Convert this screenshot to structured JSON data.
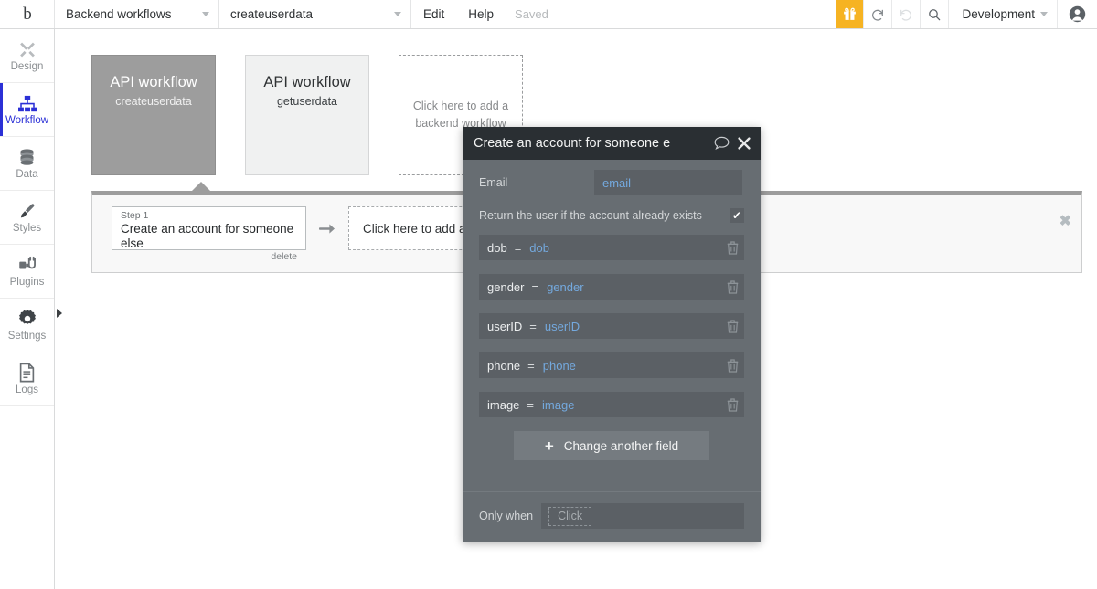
{
  "topbar": {
    "logo": "b",
    "section_select": "Backend workflows",
    "workflow_select": "createuserdata",
    "edit_label": "Edit",
    "help_label": "Help",
    "save_status": "Saved",
    "gift_icon": "gift-icon",
    "undo_icon": "undo-icon",
    "redo_icon": "redo-icon",
    "search_icon": "search-icon",
    "environment": "Development",
    "avatar_icon": "user-avatar-icon"
  },
  "sidebar": {
    "items": [
      {
        "label": "Design",
        "icon": "design-icon",
        "active": false
      },
      {
        "label": "Workflow",
        "icon": "workflow-icon",
        "active": true
      },
      {
        "label": "Data",
        "icon": "data-icon",
        "active": false
      },
      {
        "label": "Styles",
        "icon": "styles-brush-icon",
        "active": false
      },
      {
        "label": "Plugins",
        "icon": "plugins-icon",
        "active": false
      },
      {
        "label": "Settings",
        "icon": "gear-icon",
        "active": false
      },
      {
        "label": "Logs",
        "icon": "logs-document-icon",
        "active": false
      }
    ],
    "expand_arrow": "chevron-right-icon"
  },
  "canvas": {
    "cards": [
      {
        "type": "API workflow",
        "name": "createuserdata",
        "selected": true
      },
      {
        "type": "API workflow",
        "name": "getuserdata",
        "selected": false
      }
    ],
    "add_card_text": "Click here to add a backend workflow",
    "panel": {
      "step_number": "Step 1",
      "step_name": "Create an account for someone else",
      "delete_label": "delete",
      "arrow_icon": "arrow-right-icon",
      "add_action_text": "Click here to add an action...",
      "close_icon": "close-icon"
    }
  },
  "modal": {
    "title": "Create an account for someone e",
    "comment_icon": "comment-bubble-icon",
    "close_icon": "close-icon",
    "email_label": "Email",
    "email_value": "email",
    "return_user_label": "Return the user if the account already exists",
    "return_user_checked": "✔",
    "fields": [
      {
        "key": "dob",
        "eq": "=",
        "value": "dob",
        "trash_icon": "trash-icon"
      },
      {
        "key": "gender",
        "eq": "=",
        "value": "gender",
        "trash_icon": "trash-icon"
      },
      {
        "key": "userID",
        "eq": "=",
        "value": "userID",
        "trash_icon": "trash-icon"
      },
      {
        "key": "phone",
        "eq": "=",
        "value": "phone",
        "trash_icon": "trash-icon"
      },
      {
        "key": "image",
        "eq": "=",
        "value": "image",
        "trash_icon": "trash-icon"
      }
    ],
    "add_field_plus": "+",
    "add_field_label": "Change another field",
    "only_when_label": "Only when",
    "only_when_placeholder": "Click"
  },
  "colors": {
    "accent_blue": "#2b30d6",
    "gift_yellow": "#f6b322",
    "modal_header": "#2a2f33",
    "modal_body": "#676d72",
    "field_bg": "#5b6065",
    "dynamic_blue": "#74a9de",
    "selected_card": "#9d9d9d"
  }
}
